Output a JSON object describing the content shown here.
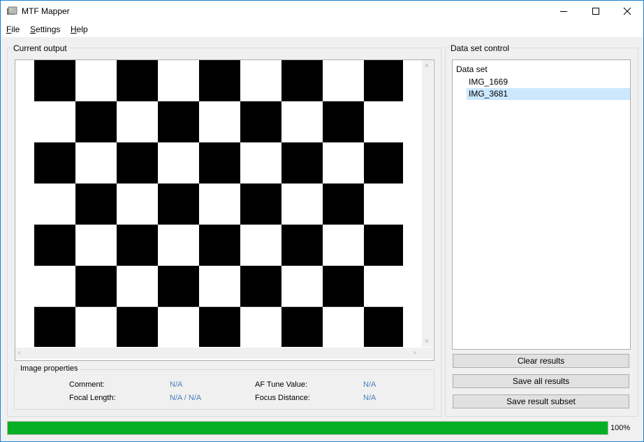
{
  "window": {
    "title": "MTF Mapper",
    "icon": "camera-app-icon",
    "controls": [
      "minimize-icon",
      "maximize-icon",
      "close-icon"
    ]
  },
  "menu": {
    "items": [
      {
        "label": "File",
        "mnemonic": "F",
        "rest": "ile"
      },
      {
        "label": "Settings",
        "mnemonic": "S",
        "rest": "ettings"
      },
      {
        "label": "Help",
        "mnemonic": "H",
        "rest": "elp"
      }
    ]
  },
  "output": {
    "group_title": "Current output",
    "image": {
      "type": "checkerboard",
      "colors": [
        "#000000",
        "#ffffff"
      ]
    }
  },
  "image_properties": {
    "group_title": "Image properties",
    "comment_label": "Comment:",
    "comment_value": "N/A",
    "focal_length_label": "Focal Length:",
    "focal_length_value": "N/A / N/A",
    "af_tune_label": "AF Tune Value:",
    "af_tune_value": "N/A",
    "focus_distance_label": "Focus Distance:",
    "focus_distance_value": "N/A"
  },
  "dataset": {
    "group_title": "Data set control",
    "root_label": "Data set",
    "items": [
      {
        "label": "IMG_1669",
        "selected": false
      },
      {
        "label": "IMG_3681",
        "selected": true
      }
    ]
  },
  "buttons": {
    "clear": "Clear results",
    "save_all": "Save all results",
    "save_subset": "Save result subset"
  },
  "progress": {
    "value": 1.0,
    "text": "100%",
    "color": "#06b025"
  },
  "colors": {
    "selection": "#cce8ff",
    "value_text": "#4a7dbf",
    "window_border": "#1883d7"
  }
}
